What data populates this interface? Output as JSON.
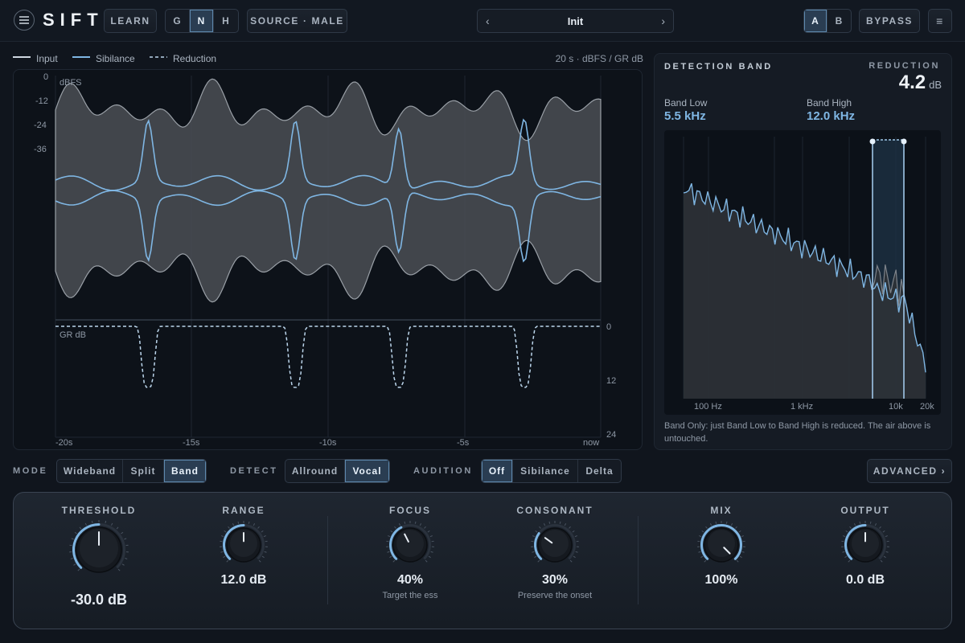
{
  "header": {
    "menu_icon": "hamburger-icon",
    "logo": "SIFT",
    "learn": "LEARN",
    "modes": [
      {
        "label": "G"
      },
      {
        "label": "N",
        "active": true
      },
      {
        "label": "H"
      }
    ],
    "source": "SOURCE · MALE",
    "preset_prev": "‹",
    "preset_name": "Init",
    "preset_next": "›",
    "ab": [
      {
        "label": "A",
        "active": true
      },
      {
        "label": "B"
      }
    ],
    "bypass": "BYPASS",
    "menu": "≡"
  },
  "legend": {
    "input": "Input",
    "sibilance": "Sibilance",
    "reduction": "Reduction",
    "scale_info": "20 s · dBFS / GR dB"
  },
  "scope": {
    "dbfs_label": "dBFS",
    "gr_label": "GR dB",
    "dbfs_ticks": [
      "0",
      "-12",
      "-24",
      "-36"
    ],
    "gr_ticks": [
      "0",
      "12",
      "24"
    ],
    "time_ticks": [
      "-20s",
      "-15s",
      "-10s",
      "-5s",
      "now"
    ]
  },
  "detection": {
    "title": "DETECTION BAND",
    "reduction_label": "REDUCTION",
    "reduction_value": "4.2",
    "reduction_unit": "dB",
    "band_low_label": "Band Low",
    "band_low_value": "5.5 kHz",
    "band_high_label": "Band High",
    "band_high_value": "12.0 kHz",
    "freq_ticks": [
      "100 Hz",
      "1 kHz",
      "10k",
      "20k"
    ],
    "note": "Band Only: just Band Low to Band High is reduced. The air above is untouched."
  },
  "controls": {
    "mode_label": "MODE",
    "mode_options": [
      {
        "label": "Wideband"
      },
      {
        "label": "Split"
      },
      {
        "label": "Band",
        "active": true
      }
    ],
    "detect_label": "DETECT",
    "detect_options": [
      {
        "label": "Allround"
      },
      {
        "label": "Vocal",
        "active": true
      }
    ],
    "audition_label": "AUDITION",
    "audition_options": [
      {
        "label": "Off",
        "active": true
      },
      {
        "label": "Sibilance"
      },
      {
        "label": "Delta"
      }
    ],
    "advanced": "ADVANCED ›"
  },
  "knobs": {
    "threshold": {
      "title": "THRESHOLD",
      "value": "-30.0 dB",
      "level": 0.5
    },
    "range": {
      "title": "RANGE",
      "value": "12.0 dB",
      "level": 0.5
    },
    "focus": {
      "title": "FOCUS",
      "value": "40%",
      "sub": "Target the ess",
      "level": 0.4
    },
    "consonant": {
      "title": "CONSONANT",
      "value": "30%",
      "sub": "Preserve the onset",
      "level": 0.3
    },
    "mix": {
      "title": "MIX",
      "value": "100%",
      "level": 1.0
    },
    "output": {
      "title": "OUTPUT",
      "value": "0.0 dB",
      "level": 0.5
    }
  },
  "colors": {
    "accent": "#7fb6e3",
    "background": "#10151d",
    "panel": "#0d1219",
    "active_segment": "#2a3d52"
  }
}
